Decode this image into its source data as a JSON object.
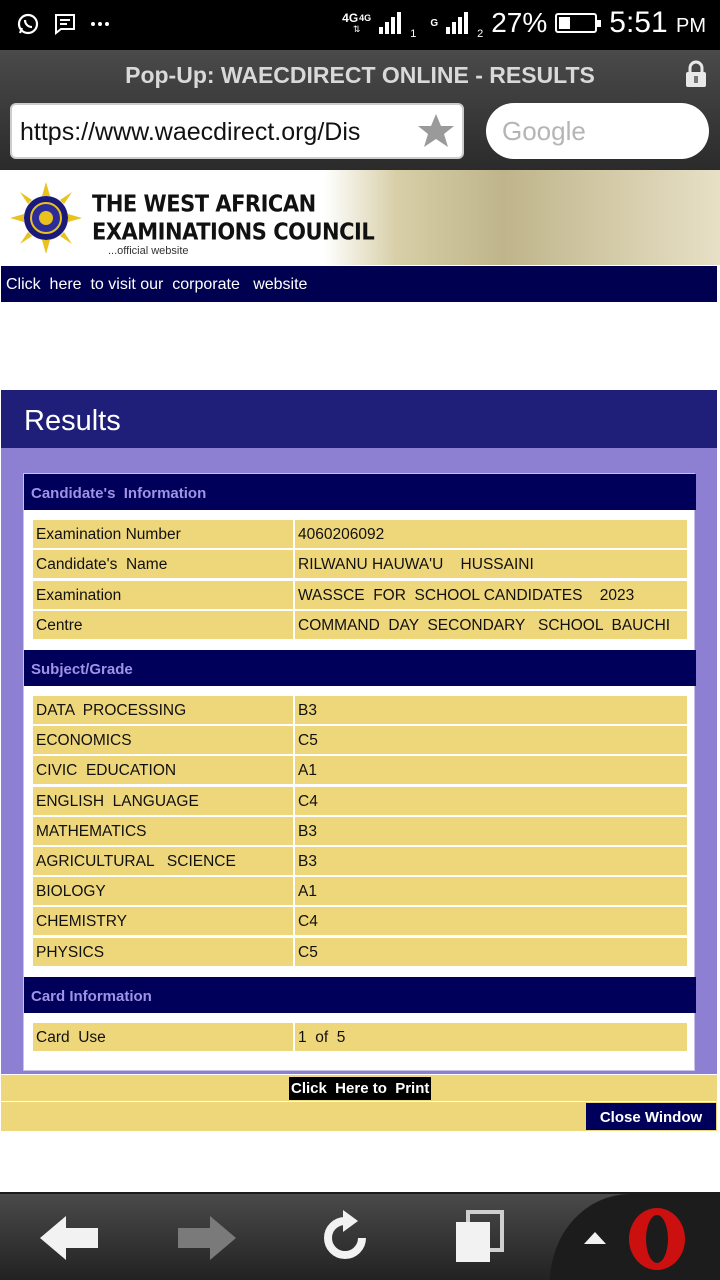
{
  "status_bar": {
    "net1": "4G",
    "net2": "4G",
    "sim1_index": "1",
    "net3": "G",
    "sim2_index": "2",
    "battery_percent": "27%",
    "battery_level": 0.27,
    "time": "5:51",
    "ampm": "PM",
    "icons": [
      "whatsapp-icon",
      "message-icon",
      "more-dots-icon"
    ]
  },
  "browser": {
    "popup_title": "Pop-Up: WAECDIRECT ONLINE - RESULTS",
    "url": "https://www.waecdirect.org/Dis",
    "search_placeholder": "Google"
  },
  "banner": {
    "title_line1": "THE WEST AFRICAN",
    "title_line2": "EXAMINATIONS COUNCIL",
    "subtitle": "...official website"
  },
  "corporate_link": "Click  here  to visit our  corporate   website",
  "results": {
    "heading": "Results",
    "candidate_section": "Candidate's  Information",
    "candidate_rows": [
      {
        "label": "Examination Number",
        "value": "4060206092"
      },
      {
        "label": "Candidate's  Name",
        "value": "RILWANU HAUWA'U    HUSSAINI"
      },
      {
        "label": "Examination",
        "value": "WASSCE  FOR  SCHOOL CANDIDATES    2023"
      },
      {
        "label": "Centre",
        "value": "COMMAND  DAY  SECONDARY   SCHOOL  BAUCHI"
      }
    ],
    "subject_section": "Subject/Grade",
    "subjects": [
      {
        "subject": "DATA  PROCESSING",
        "grade": "B3"
      },
      {
        "subject": "ECONOMICS",
        "grade": "C5"
      },
      {
        "subject": "CIVIC  EDUCATION",
        "grade": "A1"
      },
      {
        "subject": "ENGLISH  LANGUAGE",
        "grade": "C4"
      },
      {
        "subject": "MATHEMATICS",
        "grade": "B3"
      },
      {
        "subject": "AGRICULTURAL   SCIENCE",
        "grade": "B3"
      },
      {
        "subject": "BIOLOGY",
        "grade": "A1"
      },
      {
        "subject": "CHEMISTRY",
        "grade": "C4"
      },
      {
        "subject": "PHYSICS",
        "grade": "C5"
      }
    ],
    "card_section": "Card Information",
    "card_rows": [
      {
        "label": "Card  Use",
        "value": "1  of  5"
      }
    ],
    "print_label": "Click  Here to  Print",
    "close_label": "Close Window"
  },
  "colors": {
    "navy": "#00005a",
    "results_header": "#1f1f7a",
    "lavender": "#8d7fd2",
    "row_yellow": "#eed67a",
    "section_text": "#9f93e6",
    "opera_red": "#cc1010"
  },
  "nav": {
    "icons": [
      "back-arrow-icon",
      "forward-arrow-icon",
      "reload-icon",
      "tabs-icon",
      "menu-up-icon",
      "opera-icon"
    ]
  }
}
